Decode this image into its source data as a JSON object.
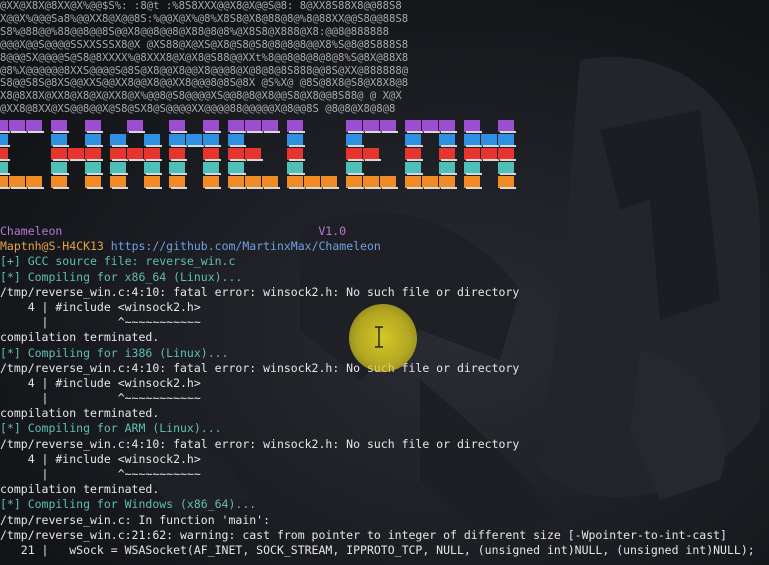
{
  "ascii_art_rows": [
    "@XX@X8X@8XX@X%@@$S%: :8@t :%8S8XXX@@X8@X@@S@8: 8@XX8S88X8@@88S8",
    "X@@X%@@@Sa8%@@XX8@X@@8S:%@@X@X%@8%X8S8@X8@88@8@%8@88XX@@S8@@88S8",
    "S8%@88@@%88@@8@@8S@@X8@@8@@8@X88@8@8%@X8S8@X888@X8:@@8@888888",
    "@@@X@@S@@@@SSXXSSSX8@X @XS88@X@XS@X8@S8@S8@8@8@8@@X8%S@8@8S888S8",
    "8@@@SX@@@@S@S8@8XXXX%@8XXX8@X@X8@S88@@XXt%8@@8@8@8@8@8%S@8X@88X8",
    "@8%X@@@@@@8XXS@@@@S@8S@X8@@X8@@X8@@@8@X@8@8@8S888@@8S@XX@888888@",
    "S8@@S8S@8XS@@XXS@@XX8@@X8@@XX8@@@8@8S@8X @S%X@ @8S@8X8@S8@X8X8@8",
    "X8@8X8X@XX8@X8@X@XX8@X%@@8@S8@@@@XS@@8@8@X8@@S8@X8@@8S88@ @ X@X",
    "@XX8@8XX@XS@@8@@X@S8@SX8@S@@@@XX@@@@88@@@@@X@8@@8S @8@8@X8@8@8"
  ],
  "app": {
    "name": "Chameleon",
    "version": "V1.0",
    "user_host": "Maptnh@S-H4CK13",
    "repo_url": "https://github.com/MartinxMax/Chameleon"
  },
  "terminal_lines": [
    {
      "t": "[+] GCC source file: reverse_win.c",
      "c": "green"
    },
    {
      "t": "[*] Compiling for x86_64 (Linux)...",
      "c": "green"
    },
    {
      "t": "/tmp/reverse_win.c:4:10: fatal error: winsock2.h: No such file or directory",
      "c": "white"
    },
    {
      "t": "    4 | #include <winsock2.h>",
      "c": "white"
    },
    {
      "t": "      |          ^~~~~~~~~~~~",
      "c": "white"
    },
    {
      "t": "compilation terminated.",
      "c": "white"
    },
    {
      "t": "[*] Compiling for i386 (Linux)...",
      "c": "green"
    },
    {
      "t": "/tmp/reverse_win.c:4:10: fatal error: winsock2.h: No such file or directory",
      "c": "white"
    },
    {
      "t": "    4 | #include <winsock2.h>",
      "c": "white"
    },
    {
      "t": "      |          ^~~~~~~~~~~~",
      "c": "white"
    },
    {
      "t": "compilation terminated.",
      "c": "white"
    },
    {
      "t": "[*] Compiling for ARM (Linux)...",
      "c": "green"
    },
    {
      "t": "/tmp/reverse_win.c:4:10: fatal error: winsock2.h: No such file or directory",
      "c": "white"
    },
    {
      "t": "    4 | #include <winsock2.h>",
      "c": "white"
    },
    {
      "t": "      |          ^~~~~~~~~~~~",
      "c": "white"
    },
    {
      "t": "compilation terminated.",
      "c": "white"
    },
    {
      "t": "[*] Compiling for Windows (x86_64)...",
      "c": "green"
    },
    {
      "t": "/tmp/reverse_win.c: In function 'main':",
      "c": "white"
    },
    {
      "t": "/tmp/reverse_win.c:21:62: warning: cast from pointer to integer of different size [-Wpointer-to-int-cast]",
      "c": "white"
    },
    {
      "t": "   21 |   wSock = WSASocket(AF_INET, SOCK_STREAM, IPPROTO_TCP, NULL, (unsigned int)NULL, (unsigned int)NULL);",
      "c": "white"
    }
  ],
  "banner_colors": [
    "#9b4fd0",
    "#2f8fe0",
    "#e8342f",
    "#4fc0b8",
    "#f08a24"
  ],
  "cursor_icon": "ibeam-cursor-icon"
}
